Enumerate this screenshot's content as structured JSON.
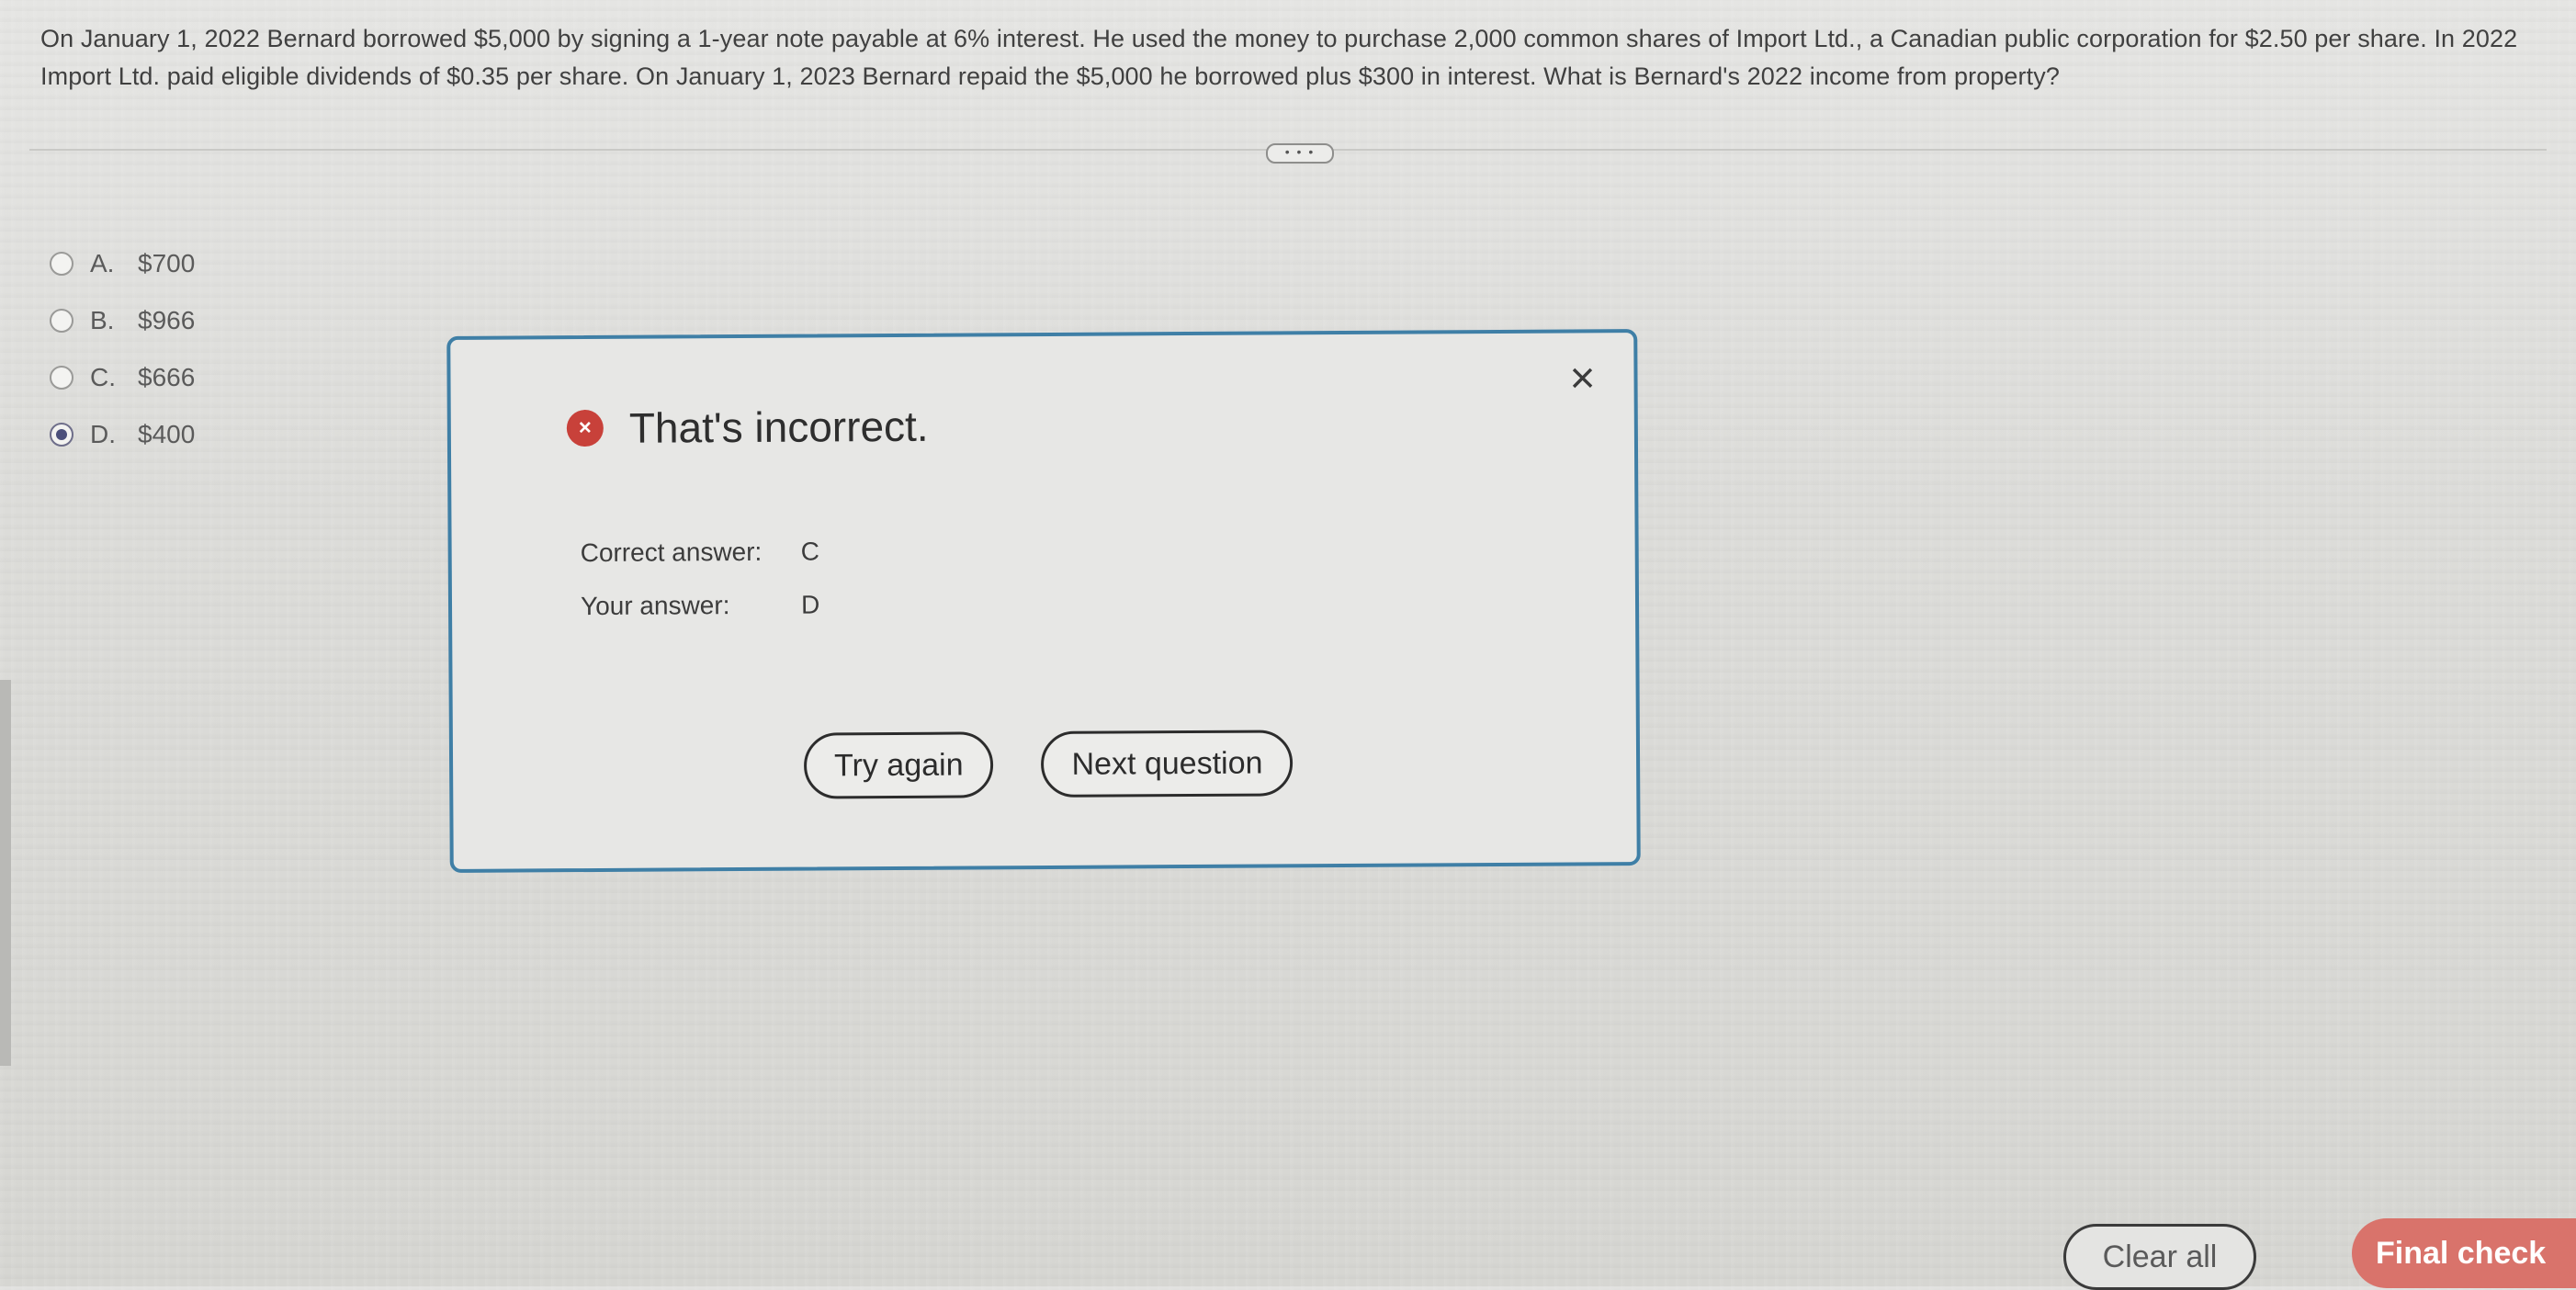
{
  "question": {
    "text": "On January 1, 2022 Bernard borrowed $5,000 by signing a 1-year note payable at 6% interest. He used the money to purchase 2,000 common shares of Import Ltd., a Canadian public corporation for $2.50 per share. In 2022 Import Ltd. paid eligible dividends of $0.35 per share. On January 1, 2023 Bernard repaid the $5,000 he borrowed plus $300 in interest. What is Bernard's 2022 income from property?"
  },
  "more_indicator": "• • •",
  "options": [
    {
      "letter": "A.",
      "value": "$700",
      "selected": false
    },
    {
      "letter": "B.",
      "value": "$966",
      "selected": false
    },
    {
      "letter": "C.",
      "value": "$666",
      "selected": false
    },
    {
      "letter": "D.",
      "value": "$400",
      "selected": true
    }
  ],
  "feedback": {
    "status": "That's incorrect.",
    "close_icon": "×",
    "status_icon": "×",
    "correct_label": "Correct answer:",
    "correct_value": "C",
    "your_label": "Your answer:",
    "your_value": "D",
    "try_again_label": "Try again",
    "next_question_label": "Next question"
  },
  "footer": {
    "clear_all_label": "Clear all",
    "final_check_label": "Final check"
  },
  "colors": {
    "modal_border": "#3f7fa6",
    "error": "#c8413a",
    "final_check": "#d9736b"
  }
}
